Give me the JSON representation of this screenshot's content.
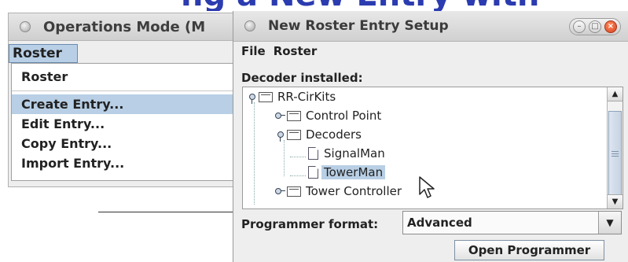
{
  "ops_window": {
    "title": "Operations Mode (M",
    "menu_roster": "Roster",
    "dropdown": {
      "header": "Roster",
      "items": [
        "Create Entry...",
        "Edit Entry...",
        "Copy Entry...",
        "Import Entry..."
      ],
      "selected_index": 0
    }
  },
  "setup_window": {
    "title": "New Roster Entry Setup",
    "menu": [
      "File",
      "Roster"
    ],
    "decoder_label": "Decoder installed:",
    "tree": [
      "RR-CirKits",
      "Control Point",
      "Decoders",
      "SignalMan",
      "TowerMan",
      "Tower Controller"
    ],
    "selected_node": "TowerMan",
    "programmer_format_label": "Programmer format:",
    "programmer_format_value": "Advanced",
    "open_programmer_label": "Open Programmer"
  },
  "colors": {
    "selection": "#b8cfe5",
    "banner_text": "#2b3bb0",
    "close_button": "#d9421c"
  },
  "icons": [
    "folder-icon",
    "document-icon",
    "tree-toggle-icon",
    "chevron-down-icon",
    "close-icon",
    "minimize-icon",
    "maximize-icon",
    "mouse-pointer-icon"
  ]
}
